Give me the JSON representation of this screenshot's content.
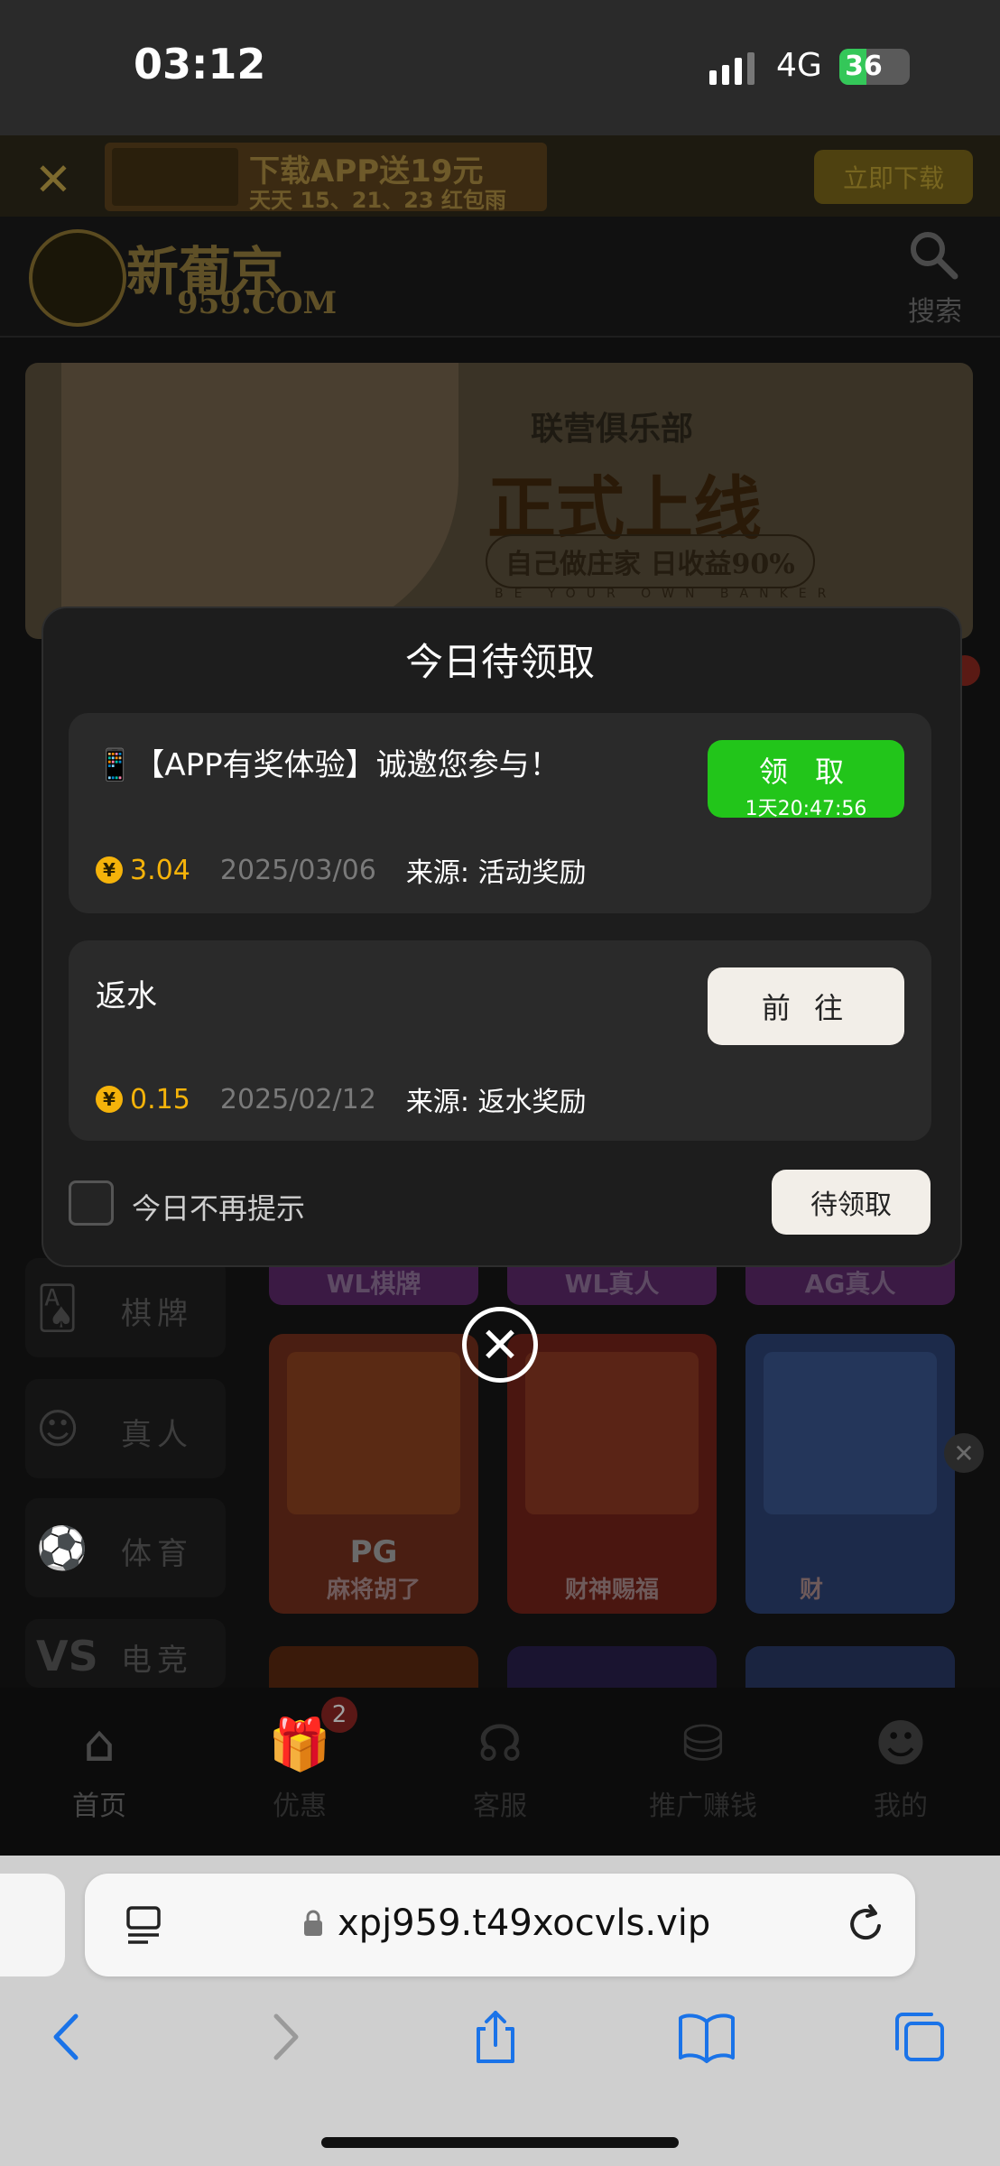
{
  "status_bar": {
    "time": "03:12",
    "network": "4G",
    "battery": "36"
  },
  "top_banner": {
    "ad_line1": "下载APP送19元",
    "ad_line2": "天天 15、21、23 红包雨",
    "download_button": "立即下载"
  },
  "header": {
    "logo_text": "新葡京",
    "logo_sub": "959.COM",
    "search_label": "搜索"
  },
  "hero": {
    "line1": "联营俱乐部",
    "line2": "正式上线",
    "line3": "自己做庄家 日收益90%",
    "line4": "BE YOUR OWN BANKER"
  },
  "categories": [
    {
      "icon": "cards-icon",
      "label": "棋牌"
    },
    {
      "icon": "dealer-icon",
      "label": "真人"
    },
    {
      "icon": "soccer-icon",
      "label": "体育"
    },
    {
      "icon": "versus-icon",
      "label": "电竞"
    }
  ],
  "category_pills": [
    "WL棋牌",
    "WL真人",
    "AG真人"
  ],
  "games": [
    {
      "brand": "PG",
      "name": "麻将胡了"
    },
    {
      "brand": "",
      "name": "财神赐福"
    },
    {
      "brand": "",
      "name": "财"
    }
  ],
  "tabbar": {
    "items": [
      "首页",
      "优惠",
      "客服",
      "推广赚钱",
      "我的"
    ],
    "promo_badge": "2"
  },
  "modal": {
    "title": "今日待领取",
    "cards": [
      {
        "title": "📱【APP有奖体验】诚邀您参与！",
        "amount": "3.04",
        "date": "2025/03/06",
        "source": "来源: 活动奖励",
        "button_label": "领 取",
        "countdown": "1天20:47:56"
      },
      {
        "title": "返水",
        "amount": "0.15",
        "date": "2025/02/12",
        "source": "来源: 返水奖励",
        "button_label": "前 往"
      }
    ],
    "checkbox_label": "今日不再提示",
    "pending_button": "待领取",
    "coin_symbol": "¥"
  },
  "browser": {
    "url": "xpj959.t49xocvls.vip"
  },
  "colors": {
    "claim_green": "#22c51a",
    "coin_gold": "#f5b30a"
  }
}
